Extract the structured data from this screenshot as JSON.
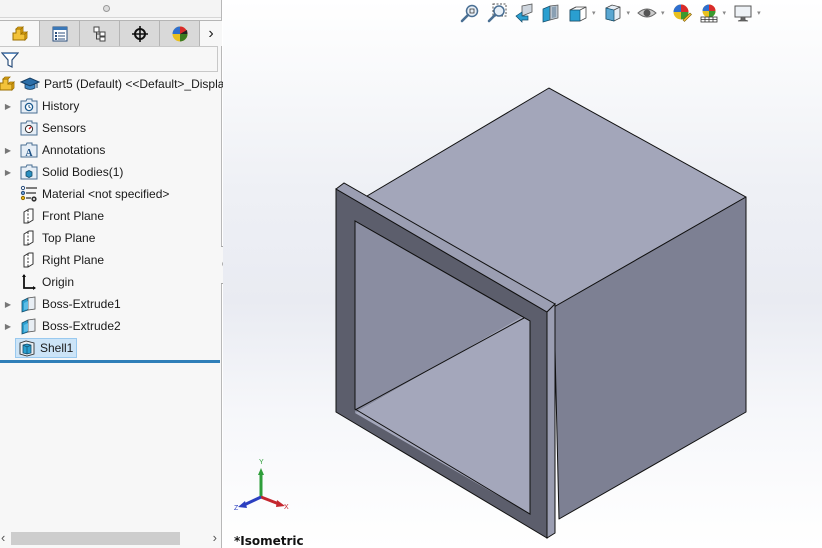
{
  "feature_manager": {
    "tabs": [
      {
        "name": "featuremanager-tree",
        "icon": "part-icon",
        "active": true
      },
      {
        "name": "property-manager",
        "icon": "property-manager-icon",
        "active": false
      },
      {
        "name": "configuration-manager",
        "icon": "configuration-manager-icon",
        "active": false
      },
      {
        "name": "dimxpert-manager",
        "icon": "crosshair-icon",
        "active": false
      },
      {
        "name": "display-manager",
        "icon": "appearance-ball-icon",
        "active": false
      }
    ],
    "tabs_more_glyph": "›",
    "filter_icon": "filter-funnel-icon",
    "tree": {
      "root": {
        "label": "Part5 (Default) <<Default>_Displa",
        "icons": [
          "part-icon",
          "graduation-cap-icon"
        ]
      },
      "items": [
        {
          "label": "History",
          "icon": "history-folder-icon",
          "expandable": true
        },
        {
          "label": "Sensors",
          "icon": "sensors-folder-icon",
          "expandable": false
        },
        {
          "label": "Annotations",
          "icon": "annotations-folder-icon",
          "expandable": true
        },
        {
          "label": "Solid Bodies(1)",
          "icon": "solid-bodies-folder-icon",
          "expandable": true
        },
        {
          "label": "Material <not specified>",
          "icon": "material-icon",
          "expandable": false
        },
        {
          "label": "Front Plane",
          "icon": "plane-icon",
          "expandable": false
        },
        {
          "label": "Top Plane",
          "icon": "plane-icon",
          "expandable": false
        },
        {
          "label": "Right Plane",
          "icon": "plane-icon",
          "expandable": false
        },
        {
          "label": "Origin",
          "icon": "origin-icon",
          "expandable": false
        },
        {
          "label": "Boss-Extrude1",
          "icon": "extrude-icon",
          "expandable": true
        },
        {
          "label": "Boss-Extrude2",
          "icon": "extrude-icon",
          "expandable": true
        },
        {
          "label": "Shell1",
          "icon": "shell-icon",
          "expandable": false,
          "selected": true
        }
      ]
    },
    "scroll": {
      "left_glyph": "‹",
      "right_glyph": "›"
    }
  },
  "heads_up_toolbar": {
    "buttons": [
      {
        "name": "zoom-to-fit",
        "icon": "zoom-to-fit-icon",
        "dropdown": false
      },
      {
        "name": "zoom-to-area",
        "icon": "zoom-to-area-icon",
        "dropdown": false
      },
      {
        "name": "previous-view",
        "icon": "previous-view-icon",
        "dropdown": false
      },
      {
        "name": "section-view",
        "icon": "section-view-icon",
        "dropdown": false
      },
      {
        "name": "view-orientation",
        "icon": "view-orientation-icon",
        "dropdown": true
      },
      {
        "name": "display-style",
        "icon": "display-style-icon",
        "dropdown": true
      },
      {
        "name": "hide-show-items",
        "icon": "eye-icon",
        "dropdown": true
      },
      {
        "name": "edit-appearance",
        "icon": "edit-appearance-icon",
        "dropdown": false
      },
      {
        "name": "apply-scene",
        "icon": "apply-scene-icon",
        "dropdown": true
      },
      {
        "name": "view-settings",
        "icon": "monitor-icon",
        "dropdown": true
      }
    ],
    "dropdown_glyph": "▾"
  },
  "viewport": {
    "view_name": "*Isometric",
    "triad": {
      "x_label": "X",
      "y_label": "Y",
      "z_label": "Z"
    },
    "colors": {
      "top_face": "#a3a6ba",
      "right_face": "#7d8093",
      "flange_front": "#5c5e6c",
      "flange_edge": "#9b9eb2",
      "inner_wall_left": "#8a8da1",
      "inner_floor": "#a4a7bb",
      "x_axis": "#c4262e",
      "y_axis": "#2e9e3a",
      "z_axis": "#2b3fc0"
    }
  }
}
